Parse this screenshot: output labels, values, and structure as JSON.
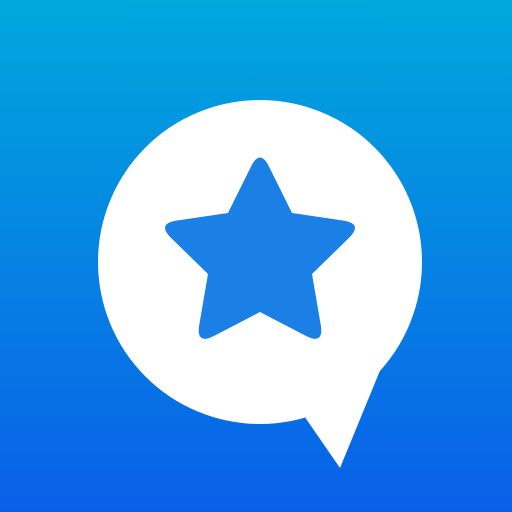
{
  "icon": {
    "name": "favorite-chat-icon",
    "glyph": "star-icon",
    "container": "speech-bubble",
    "colors": {
      "gradient_top": "#00a8dd",
      "gradient_bottom": "#0a5fe8",
      "bubble": "#ffffff",
      "star": "#1a80e6"
    }
  }
}
